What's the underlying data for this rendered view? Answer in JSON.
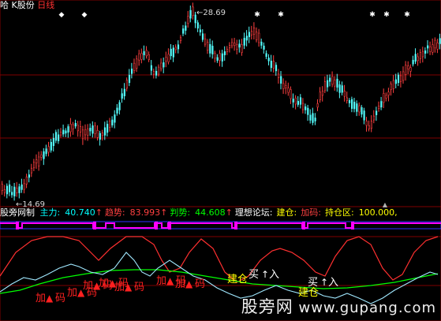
{
  "header": {
    "name": "哈 K股份",
    "period": "日线",
    "name_color": "#ffffff",
    "period_color": "#ff3030"
  },
  "price_labels": {
    "high": "28.69",
    "low": "14.69"
  },
  "indicator": {
    "name": "股旁网制",
    "items": [
      {
        "label": "主力:",
        "value": "40.740",
        "arrow": "↑",
        "label_color": "#00ffff",
        "value_color": "#00ffff",
        "arrow_color": "#ff4040"
      },
      {
        "label": "趋势:",
        "value": "83.993",
        "arrow": "↑",
        "label_color": "#ff4040",
        "value_color": "#ff4040",
        "arrow_color": "#ff4040"
      },
      {
        "label": "判势:",
        "value": "44.608",
        "arrow": "↑",
        "label_color": "#00ff00",
        "value_color": "#00ff00",
        "arrow_color": "#ff4040"
      },
      {
        "label": "理想论坛:",
        "value": "",
        "arrow": "",
        "label_color": "#ffffff",
        "value_color": "#ffffff",
        "arrow_color": "#ffffff"
      },
      {
        "label": "建仓:",
        "value": "",
        "arrow": "",
        "label_color": "#ffff00",
        "value_color": "#ffff00",
        "arrow_color": "#ffff00"
      },
      {
        "label": "加码:",
        "value": "",
        "arrow": "",
        "label_color": "#ff4040",
        "value_color": "#ff4040",
        "arrow_color": "#ff4040"
      },
      {
        "label": "持仓区:",
        "value": "100.000,",
        "arrow": "",
        "label_color": "#ffff00",
        "value_color": "#ffff00",
        "arrow_color": "#ffff00"
      }
    ]
  },
  "signals": {
    "add": "加码",
    "build": "建仓",
    "buy": "买入"
  },
  "watermark": {
    "cn": "股旁网",
    "url": "www.gupang.com"
  },
  "colors": {
    "up": "#ff4040",
    "down": "#54fcfc",
    "main": "#00ffff",
    "trend": "#ff3030",
    "judge": "#00ff00",
    "purple": "#ff00ff",
    "blue_band": "#3030ff",
    "grid": "#800000"
  }
}
